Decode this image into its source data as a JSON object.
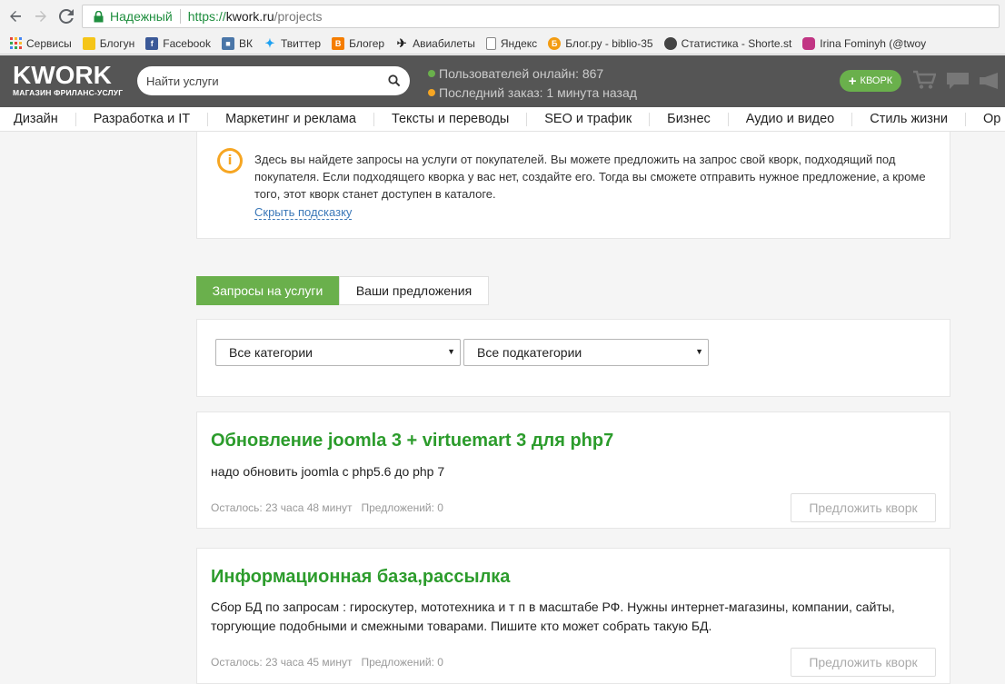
{
  "browser": {
    "secure_label": "Надежный",
    "url_scheme": "https://",
    "url_host": "kwork.ru",
    "url_path": "/projects",
    "bookmarks": [
      {
        "label": "Сервисы",
        "icon": "apps-grid-icon"
      },
      {
        "label": "Блогун",
        "icon": "blogun-icon"
      },
      {
        "label": "Facebook",
        "icon": "facebook-icon"
      },
      {
        "label": "ВК",
        "icon": "vk-icon"
      },
      {
        "label": "Твиттер",
        "icon": "twitter-icon"
      },
      {
        "label": "Блогер",
        "icon": "blogger-icon"
      },
      {
        "label": "Авиабилеты",
        "icon": "plane-icon"
      },
      {
        "label": "Яндекс",
        "icon": "page-icon"
      },
      {
        "label": "Блог.ру - biblio-35",
        "icon": "blogru-icon"
      },
      {
        "label": "Статистика - Shorte.st",
        "icon": "shortest-icon"
      },
      {
        "label": "Irina Fominyh (@twoy",
        "icon": "instagram-icon"
      }
    ]
  },
  "header": {
    "logo_main": "KWORK",
    "logo_sub": "МАГАЗИН ФРИЛАНС-УСЛУГ",
    "search_placeholder": "Найти услуги",
    "users_online": "Пользователей онлайн: 867",
    "last_order": "Последний заказ: 1 минута назад",
    "add_kwork_label": "КВОРК",
    "colors": {
      "online_dot": "#6ab04c",
      "order_dot": "#f6a623",
      "accent": "#6ab04c"
    }
  },
  "categories": [
    "Дизайн",
    "Разработка и IT",
    "Маркетинг и реклама",
    "Тексты и переводы",
    "SEO и трафик",
    "Бизнес",
    "Аудио и видео",
    "Стиль жизни",
    "Ор"
  ],
  "hint": {
    "text": "Здесь вы найдете запросы на услуги от покупателей. Вы можете предложить на запрос свой кворк, подходящий под покупателя. Если подходящего кворка у вас нет, создайте его. Тогда вы сможете отправить нужное предложение, а кроме того, этот кворк станет доступен в каталоге.",
    "hide_link": "Скрыть подсказку"
  },
  "tabs": {
    "requests": "Запросы на услуги",
    "my_offers": "Ваши предложения"
  },
  "filters": {
    "category": "Все категории",
    "subcategory": "Все подкатегории"
  },
  "projects": [
    {
      "title": "Обновление joomla 3 + virtuemart 3 для php7",
      "description": "надо обновить joomla с php5.6 до php 7",
      "time_left": "Осталось: 23 часа 48 минут",
      "offers": "Предложений: 0",
      "button": "Предложить кворк"
    },
    {
      "title": "Информационная база,рассылка",
      "description": "Сбор БД по запросам : гироскутер, мототехника и т п в масштабе РФ. Нужны интернет-магазины, компании, сайты, торгующие подобными и смежными товарами. Пишите кто может собрать такую БД.",
      "time_left": "Осталось: 23 часа 45 минут",
      "offers": "Предложений: 0",
      "button": "Предложить кворк"
    }
  ]
}
